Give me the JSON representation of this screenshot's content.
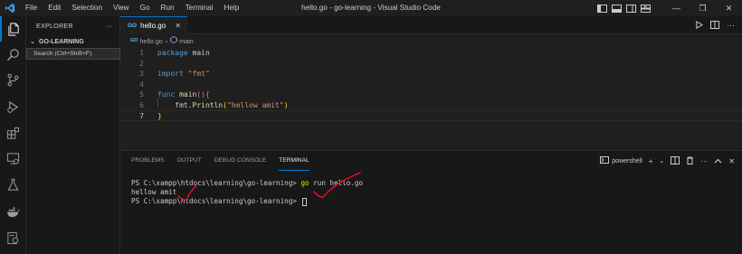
{
  "window": {
    "title": "hello.go - go-learning - Visual Studio Code",
    "menu": [
      "File",
      "Edit",
      "Selection",
      "View",
      "Go",
      "Run",
      "Terminal",
      "Help"
    ],
    "controls": {
      "minimize": "—",
      "restore": "❐",
      "close": "✕"
    }
  },
  "activity_bar": {
    "items": [
      "explorer-icon",
      "search-icon",
      "source-control-icon",
      "run-debug-icon",
      "extensions-icon",
      "remote-explorer-icon",
      "testing-icon",
      "docker-icon",
      "account-icon"
    ]
  },
  "sidebar": {
    "title": "EXPLORER",
    "more": "···",
    "folder": "GO-LEARNING",
    "tooltip": "Search (Ctrl+Shift+F)"
  },
  "editor": {
    "tab": {
      "badge": "GO",
      "label": "hello.go",
      "close": "✕"
    },
    "breadcrumb": {
      "file": "hello.go",
      "symbol": "main"
    },
    "lines": [
      {
        "n": "1",
        "tokens": [
          [
            "kw",
            "package"
          ],
          [
            "ident",
            " main"
          ]
        ]
      },
      {
        "n": "2",
        "tokens": []
      },
      {
        "n": "3",
        "tokens": [
          [
            "kw",
            "import"
          ],
          [
            "ident",
            " "
          ],
          [
            "str",
            "\"fmt\""
          ]
        ]
      },
      {
        "n": "4",
        "tokens": []
      },
      {
        "n": "5",
        "tokens": [
          [
            "kw",
            "func"
          ],
          [
            "ident",
            " "
          ],
          [
            "fn",
            "main"
          ],
          [
            "br1",
            "()"
          ],
          [
            "br1",
            "{"
          ]
        ]
      },
      {
        "n": "6",
        "tokens": [
          [
            "ident",
            "    fmt."
          ],
          [
            "fn",
            "Println"
          ],
          [
            "br2",
            "("
          ],
          [
            "str",
            "\"hellow amit\""
          ],
          [
            "br2",
            ")"
          ]
        ]
      },
      {
        "n": "7",
        "tokens": [
          [
            "br2",
            "}"
          ]
        ]
      }
    ],
    "current_line": 7
  },
  "panel": {
    "tabs": [
      "PROBLEMS",
      "OUTPUT",
      "DEBUG CONSOLE",
      "TERMINAL"
    ],
    "active_tab": 3,
    "shell": "powershell",
    "terminal": {
      "line1_prompt": "PS C:\\xampp\\htdocs\\learning\\go-learning> ",
      "line1_cmd": "go",
      "line1_args": " run hello.go",
      "line2": "hellow amit",
      "line3_prompt": "PS C:\\xampp\\htdocs\\learning\\go-learning> "
    }
  },
  "colors": {
    "accent": "#0078d4",
    "annotation": "#e81123",
    "keyword": "#569cd6",
    "string": "#ce9178"
  }
}
